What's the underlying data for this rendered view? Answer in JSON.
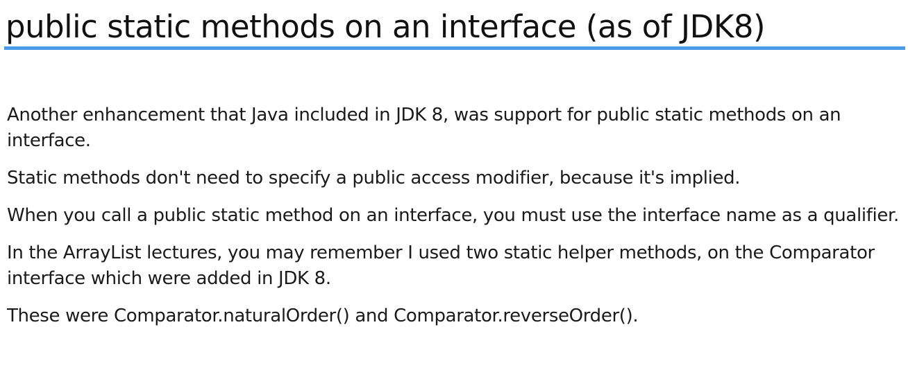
{
  "slide": {
    "title": "public static methods on an interface (as of JDK8)",
    "accent_color": "#4c9be8",
    "paragraphs": [
      "Another enhancement that Java included in JDK 8, was support for public static methods on an interface.",
      "Static methods don't need to specify a public access modifier, because it's implied.",
      "When you call a public static method on an interface, you must use the interface name as a qualifier.",
      "In the ArrayList lectures, you may remember I used two static helper methods, on the Comparator interface which were added in JDK 8.",
      "These were Comparator.naturalOrder() and Comparator.reverseOrder()."
    ]
  }
}
